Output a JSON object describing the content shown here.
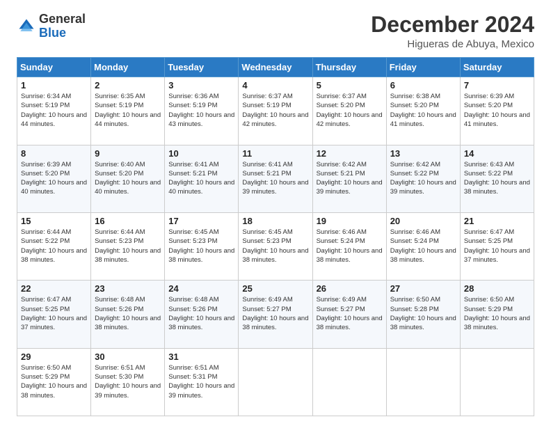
{
  "header": {
    "logo_general": "General",
    "logo_blue": "Blue",
    "month_title": "December 2024",
    "subtitle": "Higueras de Abuya, Mexico"
  },
  "calendar": {
    "days_of_week": [
      "Sunday",
      "Monday",
      "Tuesday",
      "Wednesday",
      "Thursday",
      "Friday",
      "Saturday"
    ],
    "weeks": [
      [
        {
          "day": "1",
          "sunrise": "6:34 AM",
          "sunset": "5:19 PM",
          "daylight": "10 hours and 44 minutes."
        },
        {
          "day": "2",
          "sunrise": "6:35 AM",
          "sunset": "5:19 PM",
          "daylight": "10 hours and 44 minutes."
        },
        {
          "day": "3",
          "sunrise": "6:36 AM",
          "sunset": "5:19 PM",
          "daylight": "10 hours and 43 minutes."
        },
        {
          "day": "4",
          "sunrise": "6:37 AM",
          "sunset": "5:19 PM",
          "daylight": "10 hours and 42 minutes."
        },
        {
          "day": "5",
          "sunrise": "6:37 AM",
          "sunset": "5:20 PM",
          "daylight": "10 hours and 42 minutes."
        },
        {
          "day": "6",
          "sunrise": "6:38 AM",
          "sunset": "5:20 PM",
          "daylight": "10 hours and 41 minutes."
        },
        {
          "day": "7",
          "sunrise": "6:39 AM",
          "sunset": "5:20 PM",
          "daylight": "10 hours and 41 minutes."
        }
      ],
      [
        {
          "day": "8",
          "sunrise": "6:39 AM",
          "sunset": "5:20 PM",
          "daylight": "10 hours and 40 minutes."
        },
        {
          "day": "9",
          "sunrise": "6:40 AM",
          "sunset": "5:20 PM",
          "daylight": "10 hours and 40 minutes."
        },
        {
          "day": "10",
          "sunrise": "6:41 AM",
          "sunset": "5:21 PM",
          "daylight": "10 hours and 40 minutes."
        },
        {
          "day": "11",
          "sunrise": "6:41 AM",
          "sunset": "5:21 PM",
          "daylight": "10 hours and 39 minutes."
        },
        {
          "day": "12",
          "sunrise": "6:42 AM",
          "sunset": "5:21 PM",
          "daylight": "10 hours and 39 minutes."
        },
        {
          "day": "13",
          "sunrise": "6:42 AM",
          "sunset": "5:22 PM",
          "daylight": "10 hours and 39 minutes."
        },
        {
          "day": "14",
          "sunrise": "6:43 AM",
          "sunset": "5:22 PM",
          "daylight": "10 hours and 38 minutes."
        }
      ],
      [
        {
          "day": "15",
          "sunrise": "6:44 AM",
          "sunset": "5:22 PM",
          "daylight": "10 hours and 38 minutes."
        },
        {
          "day": "16",
          "sunrise": "6:44 AM",
          "sunset": "5:23 PM",
          "daylight": "10 hours and 38 minutes."
        },
        {
          "day": "17",
          "sunrise": "6:45 AM",
          "sunset": "5:23 PM",
          "daylight": "10 hours and 38 minutes."
        },
        {
          "day": "18",
          "sunrise": "6:45 AM",
          "sunset": "5:23 PM",
          "daylight": "10 hours and 38 minutes."
        },
        {
          "day": "19",
          "sunrise": "6:46 AM",
          "sunset": "5:24 PM",
          "daylight": "10 hours and 38 minutes."
        },
        {
          "day": "20",
          "sunrise": "6:46 AM",
          "sunset": "5:24 PM",
          "daylight": "10 hours and 38 minutes."
        },
        {
          "day": "21",
          "sunrise": "6:47 AM",
          "sunset": "5:25 PM",
          "daylight": "10 hours and 37 minutes."
        }
      ],
      [
        {
          "day": "22",
          "sunrise": "6:47 AM",
          "sunset": "5:25 PM",
          "daylight": "10 hours and 37 minutes."
        },
        {
          "day": "23",
          "sunrise": "6:48 AM",
          "sunset": "5:26 PM",
          "daylight": "10 hours and 38 minutes."
        },
        {
          "day": "24",
          "sunrise": "6:48 AM",
          "sunset": "5:26 PM",
          "daylight": "10 hours and 38 minutes."
        },
        {
          "day": "25",
          "sunrise": "6:49 AM",
          "sunset": "5:27 PM",
          "daylight": "10 hours and 38 minutes."
        },
        {
          "day": "26",
          "sunrise": "6:49 AM",
          "sunset": "5:27 PM",
          "daylight": "10 hours and 38 minutes."
        },
        {
          "day": "27",
          "sunrise": "6:50 AM",
          "sunset": "5:28 PM",
          "daylight": "10 hours and 38 minutes."
        },
        {
          "day": "28",
          "sunrise": "6:50 AM",
          "sunset": "5:29 PM",
          "daylight": "10 hours and 38 minutes."
        }
      ],
      [
        {
          "day": "29",
          "sunrise": "6:50 AM",
          "sunset": "5:29 PM",
          "daylight": "10 hours and 38 minutes."
        },
        {
          "day": "30",
          "sunrise": "6:51 AM",
          "sunset": "5:30 PM",
          "daylight": "10 hours and 39 minutes."
        },
        {
          "day": "31",
          "sunrise": "6:51 AM",
          "sunset": "5:31 PM",
          "daylight": "10 hours and 39 minutes."
        },
        null,
        null,
        null,
        null
      ]
    ]
  }
}
